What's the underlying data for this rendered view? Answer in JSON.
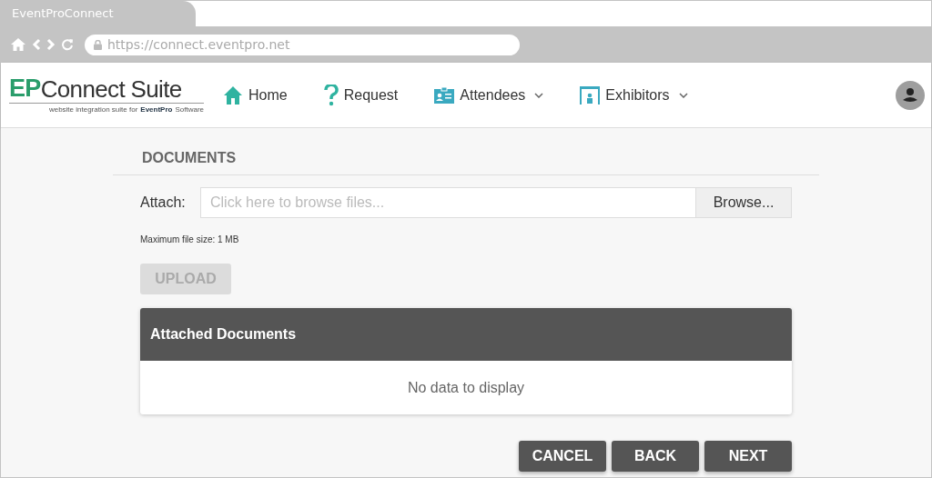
{
  "browser": {
    "tab_title": "EventProConnect",
    "url": "https://connect.eventpro.net"
  },
  "logo": {
    "mark": "EP",
    "name": "Connect Suite",
    "tagline": "website integration suite for",
    "brand": "EventPro",
    "brand_suffix": "Software"
  },
  "nav": [
    {
      "kind": "home",
      "label": "Home",
      "dropdown": false
    },
    {
      "kind": "help",
      "label": "Request",
      "dropdown": false
    },
    {
      "kind": "badge",
      "label": "Attendees",
      "dropdown": true
    },
    {
      "kind": "booth",
      "label": "Exhibitors",
      "dropdown": true
    }
  ],
  "section_title": "DOCUMENTS",
  "attach": {
    "label": "Attach:",
    "placeholder": "Click here to browse files...",
    "browse_button": "Browse...",
    "hint": "Maximum file size: 1 MB"
  },
  "upload_button": {
    "label": "UPLOAD",
    "disabled": true
  },
  "attached_table": {
    "title": "Attached Documents",
    "empty_text": "No data to display"
  },
  "buttons": [
    "CANCEL",
    "BACK",
    "NEXT"
  ]
}
